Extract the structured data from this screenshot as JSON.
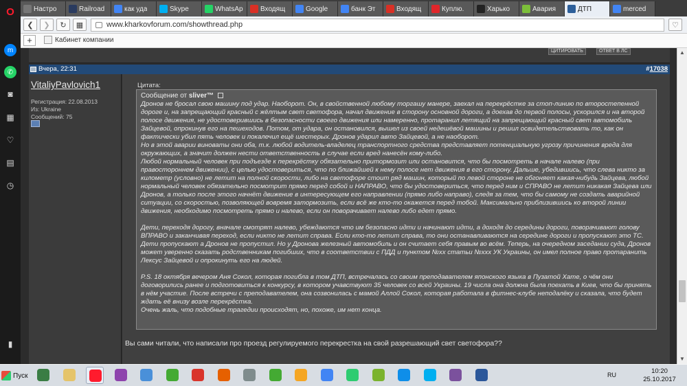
{
  "browser": {
    "tabs": [
      {
        "label": "Настро",
        "color": "#777777"
      },
      {
        "label": "Railroad",
        "color": "#2a3b5f"
      },
      {
        "label": "как уда",
        "color": "#4285f4"
      },
      {
        "label": "Skype",
        "color": "#00aff0"
      },
      {
        "label": "WhatsAp",
        "color": "#25d366"
      },
      {
        "label": "Входящ",
        "color": "#d93025"
      },
      {
        "label": "Google",
        "color": "#4285f4"
      },
      {
        "label": "банк Эт",
        "color": "#4285f4"
      },
      {
        "label": "Входящ",
        "color": "#d93025"
      },
      {
        "label": "Куплю.",
        "color": "#e0262a"
      },
      {
        "label": "Харько",
        "color": "#222222"
      },
      {
        "label": "Авария",
        "color": "#7cbf3a"
      },
      {
        "label": "ДТП",
        "color": "#2d5f9a"
      },
      {
        "label": "merced",
        "color": "#4285f4"
      }
    ],
    "url": "www.kharkovforum.com/showthread.php",
    "bookmark_label": "Кабинет компании"
  },
  "post": {
    "date": "Вчера, 22:31",
    "number_prefix": "#",
    "number": "17038",
    "top_buttons": [
      "ЦИТИРОВАТЬ",
      "ОТВЕТ В ЛС"
    ],
    "user": {
      "name": "VitaliyPavlovich1",
      "registration": "Регистрация: 22.08.2013",
      "location": "Из: Ukraine",
      "messages": "Сообщений: 75"
    },
    "quote_label": "Цитата:",
    "quote_author_prefix": "Сообщение от",
    "quote_author": "sliver™",
    "quote_paragraphs": [
      "Дронов не бросал свою машину под удар. Наоборот. Он, в свойственной любому торгашу манере, заехал на перекрёстке за стоп-линию по второстепенной дороге и, на запрещающий красный с жёлтым свет светофора, начал движение в сторону основной дороги, а доехав до первой полосы, ускорился и на второй полосе движения, не удостоверившись в безопасности своего движения или намеренно, протаранил летящий на запрещающий красный свет автомобиль Зайцевой, опрокинув его на пешеходов. Потом, от удара, он остановился, вышел из своей недешёвой машины и решил освидетельствовать то, как он фактически убил пять человек и покалечил ещё шестерых. Дронов ударил авто Зайцевой, а не наоборот.",
      "Но в этой аварии виноваты они оба, т.к. любой водитель-владелец транспортного средства представляет потенциальную угрозу причинения вреда для окружающих, а значит должен нести ответственность в случае если вред нанесён кому-либо.",
      "Любой нормальный человек при подъезде к перекрёстку обязательно притормозит или остановится, что бы посмотреть в начале налево (при правостороннем движении), с целью удостовериться, что по ближайшей к нему полосе нет движения в его сторону. Дальше, убедившись, что слева никто за километр (условно) не летит на полной скорости, либо на светофоре стоит ряд машин, который по левой стороне не обгоняет какая-нибудь Зайцева, любой нормальный человек обязательно посмотрит прямо перед собой и НАПРАВО, что бы удостовериться, что перед ним и СПРАВО не летит никакая Зайцева или Дронов, а только после этого начнёт движение в интересующем его направлении (прямо либо направо), следя за тем, что бы самому не создать аварийной ситуации, со скоростью, позволяющей вовремя затормозить, если всё же кто-то окажется перед тобой. Максимально приблизившись ко второй линии движения, необходимо посмотреть прямо и налево, если он поворачивает налево либо едет прямо."
    ],
    "quote_paragraphs_2": [
      "Дети, переходя дорогу, вначале смотрят налево, убеждаются что им безопасно идти и начинают идти, а доходя до середины дороги, поворачивают голову ВПРАВО и заканчивая переход, если никто не летит справа. Если кто-то летит справа, то они останавливаются на середине дороги и пропускают это ТС. Дети пропускают а Дронов не пропустил. Но у Дронова железный автомобиль и он считает себя правым во всём. Теперь, на очередном заседании суда, Дронов может уверенно сказать родственникам погибших, что в соответствии с ПДД и пунктом №хх статьи №ххх УК Украины, он имел полное право протаранить Лексус Зайцевой и опрокинуть его на людей."
    ],
    "quote_paragraphs_3": [
      "P.S. 18 октября вечером Аня Сокол, которая погибла в том ДТП, встречалась со своим преподавателем японского языка в Пузатой Хате, о чём они договорились ранее и подготовиться к конкурсу, в котором учавствуют 35 человек со всей Украины. 19 числа она должна была поехать в Киев, что бы принять в нём участие. После встречи с преподавателем, она созвонилась с мамой Аллой Сокол, которая работала в фитнес-клубе неподалёку и сказала, что будет ждать её внизу возле перекрёстка.",
      "Очень жаль, что подобные трагедии происходят, но, похоже, им нет конца."
    ],
    "reply_text": "Вы сами читали, что написали про проезд регулируемого перекрестка на свой разрешающий свет светофора??"
  },
  "taskbar": {
    "start_label": "Пуск",
    "icons": [
      "app-icon",
      "folder-icon",
      "opera-icon",
      "winrar-icon",
      "media-icon",
      "icq-icon",
      "acrobat-icon",
      "firefox-icon",
      "usb-icon",
      "icq-icon",
      "mail-agent-icon",
      "chrome-icon",
      "utorrent-icon",
      "wechat-icon",
      "teamviewer-icon",
      "skype-icon",
      "viber-icon",
      "word-icon"
    ],
    "language": "RU",
    "time": "10:20",
    "date": "25.10.2017"
  }
}
